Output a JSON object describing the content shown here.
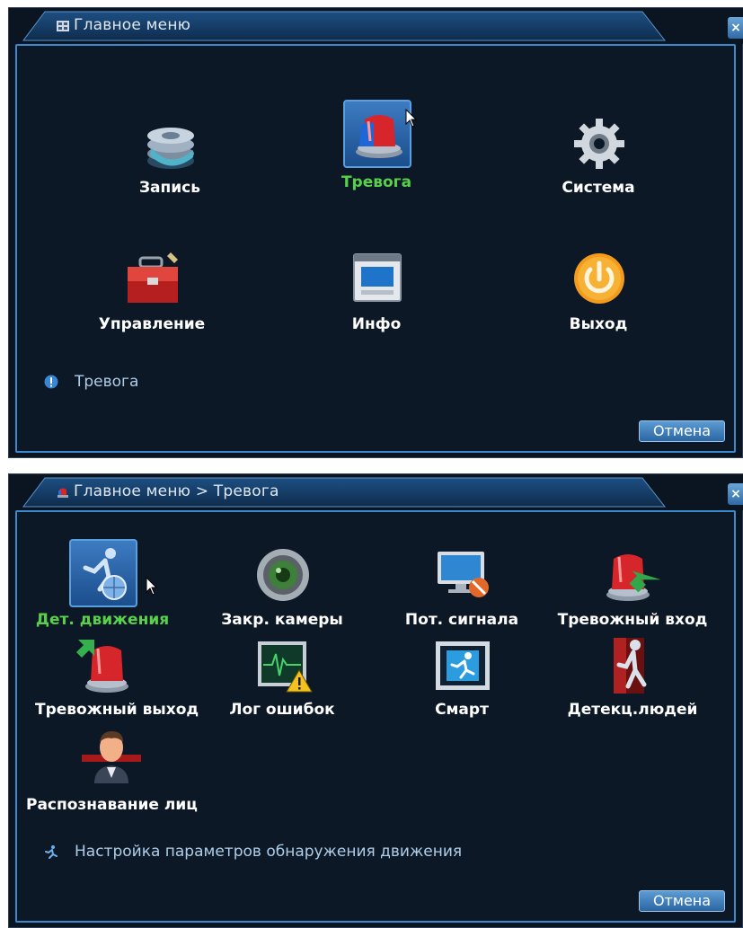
{
  "main_menu": {
    "title": "Главное меню",
    "items": [
      {
        "label": "Запись",
        "icon": "film-reel-icon"
      },
      {
        "label": "Тревога",
        "icon": "alarm-siren-icon",
        "selected": true
      },
      {
        "label": "Система",
        "icon": "gear-icon"
      },
      {
        "label": "Управление",
        "icon": "toolbox-icon"
      },
      {
        "label": "Инфо",
        "icon": "info-window-icon"
      },
      {
        "label": "Выход",
        "icon": "power-icon"
      }
    ],
    "hint": "Тревога",
    "cancel_label": "Отмена"
  },
  "alarm_menu": {
    "title": "Главное меню > Тревога",
    "items": [
      {
        "label": "Дет. движения",
        "icon": "motion-detect-icon",
        "selected": true
      },
      {
        "label": "Закр. камеры",
        "icon": "camera-blind-icon"
      },
      {
        "label": "Пот. сигнала",
        "icon": "video-loss-icon"
      },
      {
        "label": "Тревожный вход",
        "icon": "alarm-input-icon"
      },
      {
        "label": "Тревожный выход",
        "icon": "alarm-output-icon"
      },
      {
        "label": "Лог ошибок",
        "icon": "error-log-icon"
      },
      {
        "label": "Смарт",
        "icon": "smart-icon"
      },
      {
        "label": "Детекц.людей",
        "icon": "human-detect-icon"
      },
      {
        "label": "Распознавание лиц",
        "icon": "face-recognition-icon"
      }
    ],
    "hint": "Настройка параметров обнаружения движения",
    "cancel_label": "Отмена"
  },
  "colors": {
    "background": "#0d1826",
    "border": "#3b8ad0",
    "selected_text": "#57d14a",
    "text": "#ffffff",
    "hint_text": "#aecde8"
  }
}
